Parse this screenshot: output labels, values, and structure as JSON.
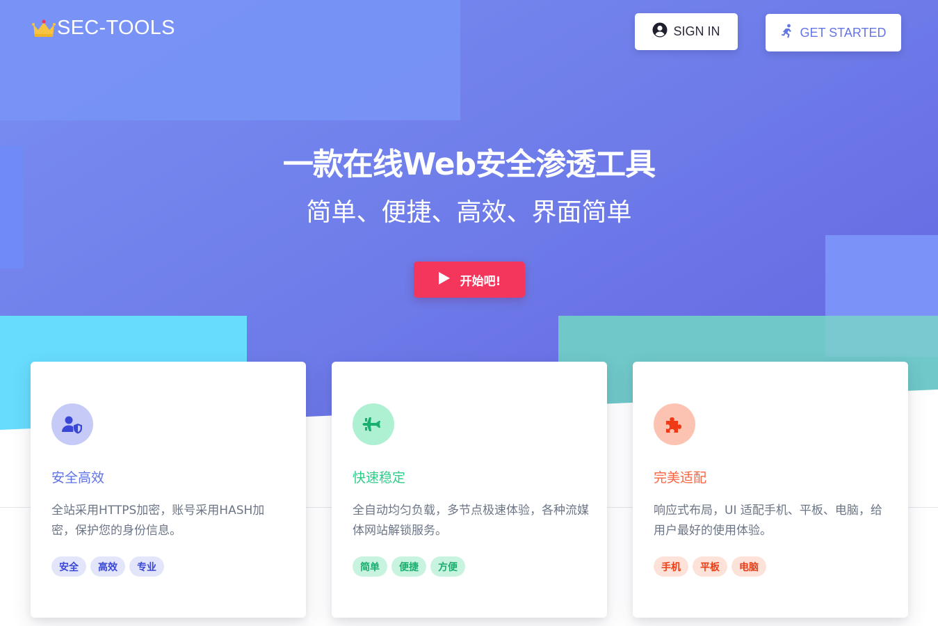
{
  "brand": {
    "name": "SEC-TOOLS",
    "icon": "crown-logo-icon"
  },
  "nav": {
    "sign_in": "SIGN IN",
    "get_started": "GET STARTED"
  },
  "hero": {
    "title": "一款在线Web安全渗透工具",
    "subtitle": "简单、便捷、高效、界面简单",
    "cta": "开始吧!"
  },
  "colors": {
    "accent": "#5e72e4",
    "danger": "#f5365c",
    "success": "#2dce89",
    "warning": "#fb6340"
  },
  "cards": [
    {
      "icon": "user-shield-icon",
      "title": "安全高效",
      "desc": "全站采用HTTPS加密，账号采用HASH加密，保护您的身份信息。",
      "tags": [
        "安全",
        "高效",
        "专业"
      ]
    },
    {
      "icon": "fighter-jet-icon",
      "title": "快速稳定",
      "desc": "全自动均匀负载，多节点极速体验，各种流媒体网站解锁服务。",
      "tags": [
        "简单",
        "便捷",
        "方便"
      ]
    },
    {
      "icon": "puzzle-piece-icon",
      "title": "完美适配",
      "desc": "响应式布局，UI 适配手机、平板、电脑，给用户最好的使用体验。",
      "tags": [
        "手机",
        "平板",
        "电脑"
      ]
    }
  ]
}
